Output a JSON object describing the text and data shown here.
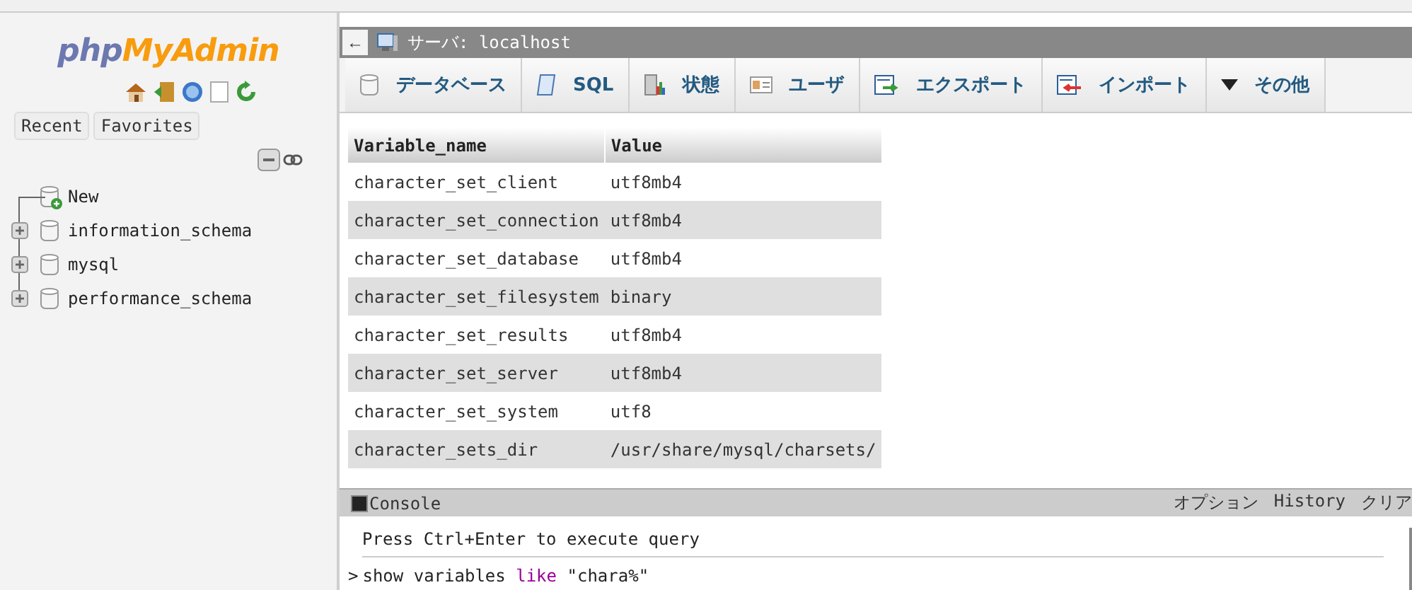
{
  "sidebar": {
    "logo": {
      "part1": "php",
      "part2": "MyAdmin"
    },
    "tabs": [
      {
        "label": "Recent"
      },
      {
        "label": "Favorites"
      }
    ],
    "tree": [
      {
        "label": "New",
        "kind": "new"
      },
      {
        "label": "information_schema",
        "kind": "db"
      },
      {
        "label": "mysql",
        "kind": "db"
      },
      {
        "label": "performance_schema",
        "kind": "db"
      }
    ]
  },
  "topbar": {
    "back": "←",
    "title": "サーバ: localhost"
  },
  "tabs": [
    {
      "label": "データベース",
      "kind": "db"
    },
    {
      "label": "SQL",
      "kind": "sql"
    },
    {
      "label": "状態",
      "kind": "chart"
    },
    {
      "label": "ユーザ",
      "kind": "user"
    },
    {
      "label": "エクスポート",
      "kind": "export"
    },
    {
      "label": "インポート",
      "kind": "import"
    },
    {
      "label": "その他",
      "kind": "more"
    }
  ],
  "table": {
    "columns": [
      "Variable_name",
      "Value"
    ],
    "rows": [
      [
        "character_set_client",
        "utf8mb4"
      ],
      [
        "character_set_connection",
        "utf8mb4"
      ],
      [
        "character_set_database",
        "utf8mb4"
      ],
      [
        "character_set_filesystem",
        "binary"
      ],
      [
        "character_set_results",
        "utf8mb4"
      ],
      [
        "character_set_server",
        "utf8mb4"
      ],
      [
        "character_set_system",
        "utf8"
      ],
      [
        "character_sets_dir",
        "/usr/share/mysql/charsets/"
      ]
    ]
  },
  "console": {
    "title": "Console",
    "actions": [
      "オプション",
      "History",
      "クリア"
    ],
    "hint": "Press Ctrl+Enter to execute query",
    "prompt": ">",
    "query": [
      {
        "text": "show variables ",
        "kind": "plain"
      },
      {
        "text": "like",
        "kind": "keyword"
      },
      {
        "text": " \"chara%\"",
        "kind": "plain"
      }
    ]
  }
}
